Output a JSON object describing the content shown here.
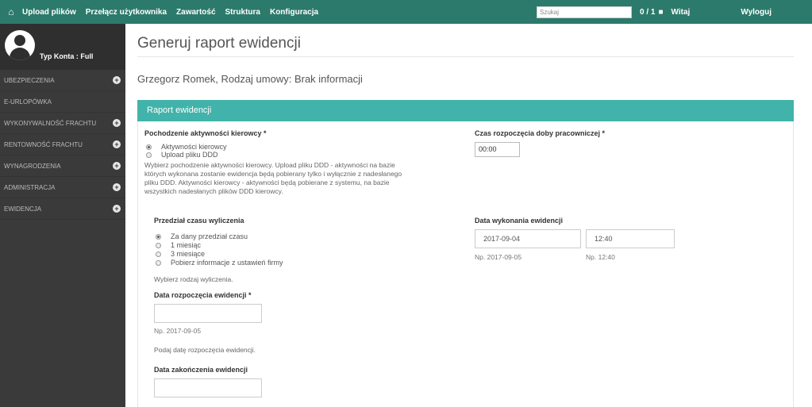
{
  "topbar": {
    "nav": [
      "Upload plików",
      "Przełącz użytkownika",
      "Zawartość",
      "Struktura",
      "Konfiguracja"
    ],
    "search_placeholder": "Szukaj",
    "counter": "0 / 1",
    "greeting": "Witaj",
    "logout": "Wyloguj"
  },
  "sidebar": {
    "account_type": "Typ Konta : Full",
    "items": [
      {
        "label": "UBEZPIECZENIA",
        "expandable": true
      },
      {
        "label": "E-URLOPÓWKA",
        "expandable": false
      },
      {
        "label": "WYKONYWALNOŚĆ FRACHTU",
        "expandable": true
      },
      {
        "label": "RENTOWNOŚĆ FRACHTU",
        "expandable": true
      },
      {
        "label": "WYNAGRODZENIA",
        "expandable": true
      },
      {
        "label": "ADMINISTRACJA",
        "expandable": true
      },
      {
        "label": "EWIDENCJA",
        "expandable": true
      }
    ]
  },
  "page": {
    "title": "Generuj raport ewidencji",
    "subtitle": "Grzegorz Romek, Rodzaj umowy: Brak informacji",
    "panel_title": "Raport ewidencji"
  },
  "form": {
    "origin": {
      "label": "Pochodzenie aktywności kierowcy *",
      "options": [
        "Aktywności kierowcy",
        "Upload pliku DDD"
      ],
      "selected": 0,
      "help": [
        "Wybierz pochodzenie aktywności kierowcy. Upload pliku DDD - aktywności na bazie",
        "których wykonana zostanie ewidencja będą pobierany tylko i wyłącznie z nadesłanego",
        "pliku DDD. Aktywności kierowcy - aktywności będą pobierane z systemu, na bazie",
        "wszystkich nadesłanych plików DDD kierowcy."
      ]
    },
    "workday_start": {
      "label": "Czas rozpoczęcia doby pracowniczej *",
      "value": "00:00"
    },
    "range": {
      "label": "Przedział czasu wyliczenia",
      "options": [
        "Za dany przedział czasu",
        "1 miesiąc",
        "3 miesiące",
        "Pobierz informacje z ustawień firmy"
      ],
      "selected": 0,
      "help": "Wybierz rodzaj wyliczenia."
    },
    "execution_date": {
      "label": "Data wykonania ewidencji",
      "date": "2017-09-04",
      "time": "12:40",
      "date_hint": "Np. 2017-09-05",
      "time_hint": "Np. 12:40"
    },
    "start_date": {
      "label": "Data rozpoczęcia ewidencji *",
      "value": "",
      "hint": "Np. 2017-09-05",
      "help": "Podaj datę rozpoczęcia ewidencji."
    },
    "end_date": {
      "label": "Data zakończenia ewidencji",
      "value": ""
    }
  }
}
